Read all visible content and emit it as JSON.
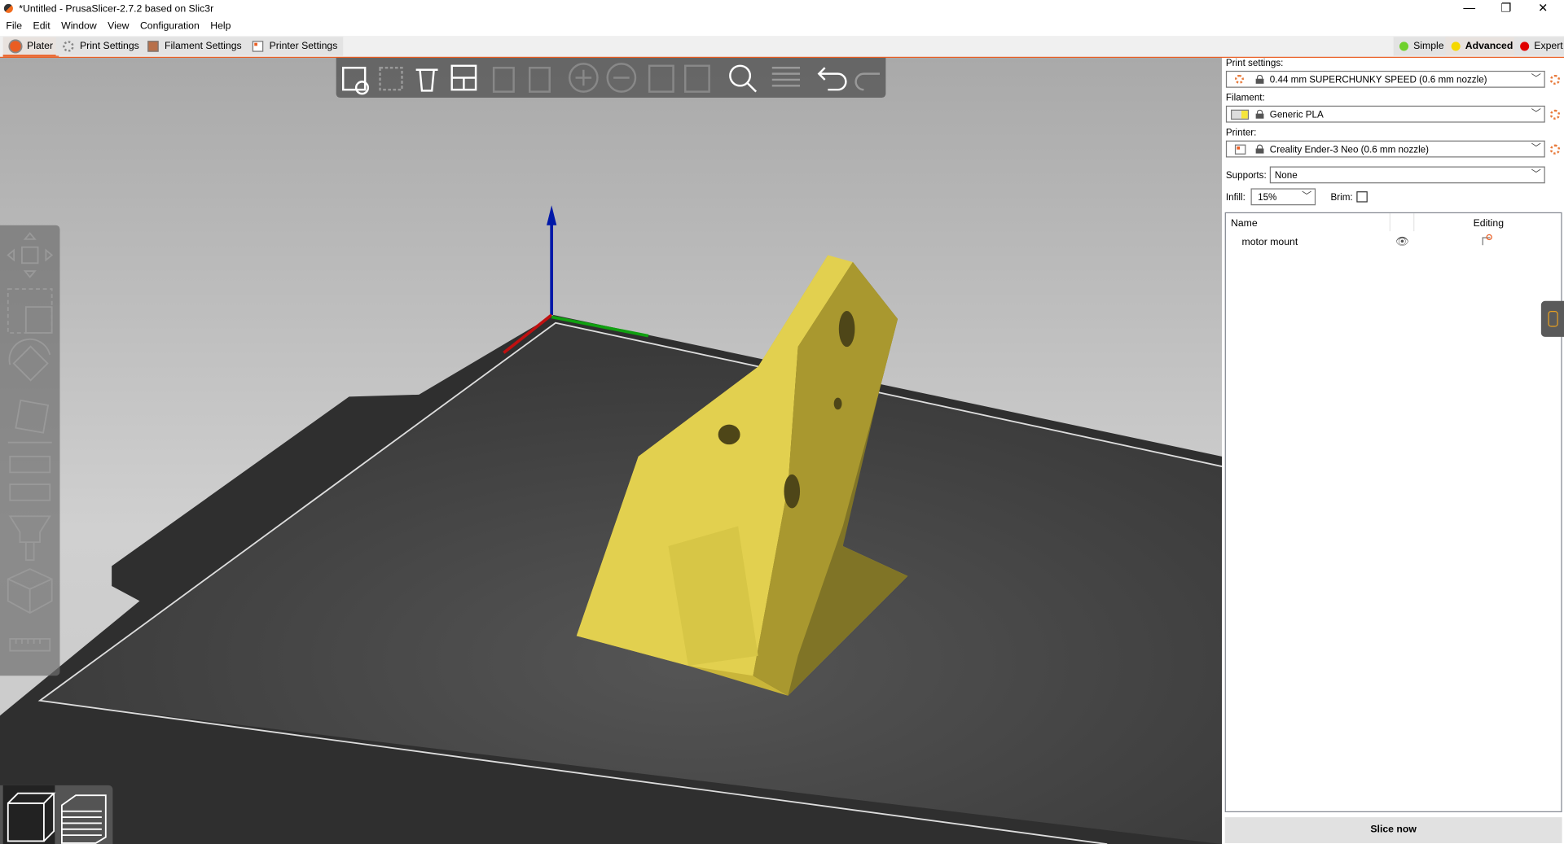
{
  "window": {
    "title": "*Untitled - PrusaSlicer-2.7.2 based on Slic3r",
    "minimize": "—",
    "restore": "❐",
    "close": "✕"
  },
  "menu": [
    "File",
    "Edit",
    "Window",
    "View",
    "Configuration",
    "Help"
  ],
  "tabs": [
    {
      "label": "Plater"
    },
    {
      "label": "Print Settings"
    },
    {
      "label": "Filament Settings"
    },
    {
      "label": "Printer Settings"
    }
  ],
  "modes": [
    {
      "label": "Simple",
      "color": "#6fd12d"
    },
    {
      "label": "Advanced",
      "color": "#f5d800"
    },
    {
      "label": "Expert",
      "color": "#e00000"
    }
  ],
  "sidebar": {
    "print_label": "Print settings:",
    "print_value": "0.44 mm SUPERCHUNKY SPEED (0.6 mm nozzle)",
    "filament_label": "Filament:",
    "filament_value": "Generic PLA",
    "filament_color": "#f5e53a",
    "printer_label": "Printer:",
    "printer_value": "Creality Ender-3 Neo (0.6 mm nozzle)",
    "supports_label": "Supports:",
    "supports_value": "None",
    "infill_label": "Infill:",
    "infill_value": "15%",
    "brim_label": "Brim:",
    "brim_checked": false,
    "list_headers": {
      "name": "Name",
      "editing": "Editing"
    },
    "objects": [
      {
        "name": "motor mount"
      }
    ],
    "slice_button": "Slice now"
  },
  "colors": {
    "accent": "#ea5d22",
    "model": "#e0cf4a",
    "bed": "#3a3a3a"
  }
}
